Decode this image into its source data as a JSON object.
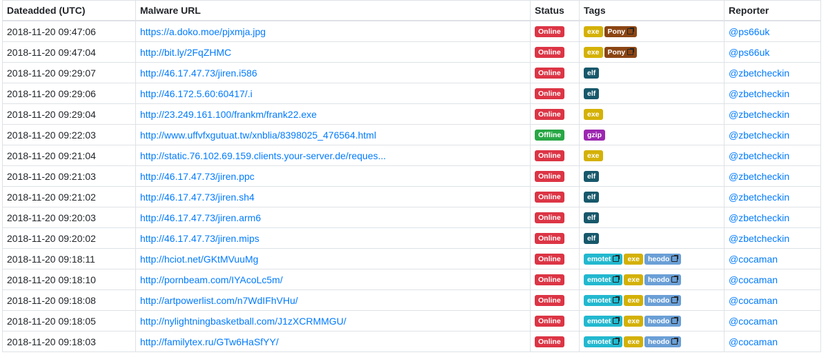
{
  "table": {
    "headers": [
      "Dateadded (UTC)",
      "Malware URL",
      "Status",
      "Tags",
      "Reporter"
    ],
    "rows": [
      {
        "date": "2018-11-20 09:47:06",
        "url": "https://a.doko.moe/pjxmja.jpg",
        "status": "Online",
        "tags": [
          {
            "label": "exe",
            "link": false
          },
          {
            "label": "Pony",
            "link": true
          }
        ],
        "reporter": "@ps66uk"
      },
      {
        "date": "2018-11-20 09:47:04",
        "url": "http://bit.ly/2FqZHMC",
        "status": "Online",
        "tags": [
          {
            "label": "exe",
            "link": false
          },
          {
            "label": "Pony",
            "link": true
          }
        ],
        "reporter": "@ps66uk"
      },
      {
        "date": "2018-11-20 09:29:07",
        "url": "http://46.17.47.73/jiren.i586",
        "status": "Online",
        "tags": [
          {
            "label": "elf",
            "link": false
          }
        ],
        "reporter": "@zbetcheckin"
      },
      {
        "date": "2018-11-20 09:29:06",
        "url": "http://46.172.5.60:60417/.i",
        "status": "Online",
        "tags": [
          {
            "label": "elf",
            "link": false
          }
        ],
        "reporter": "@zbetcheckin"
      },
      {
        "date": "2018-11-20 09:29:04",
        "url": "http://23.249.161.100/frankm/frank22.exe",
        "status": "Online",
        "tags": [
          {
            "label": "exe",
            "link": false
          }
        ],
        "reporter": "@zbetcheckin"
      },
      {
        "date": "2018-11-20 09:22:03",
        "url": "http://www.uffvfxgutuat.tw/xnblia/8398025_476564.html",
        "status": "Offline",
        "tags": [
          {
            "label": "gzip",
            "link": false
          }
        ],
        "reporter": "@zbetcheckin"
      },
      {
        "date": "2018-11-20 09:21:04",
        "url": "http://static.76.102.69.159.clients.your-server.de/reques...",
        "status": "Online",
        "tags": [
          {
            "label": "exe",
            "link": false
          }
        ],
        "reporter": "@zbetcheckin"
      },
      {
        "date": "2018-11-20 09:21:03",
        "url": "http://46.17.47.73/jiren.ppc",
        "status": "Online",
        "tags": [
          {
            "label": "elf",
            "link": false
          }
        ],
        "reporter": "@zbetcheckin"
      },
      {
        "date": "2018-11-20 09:21:02",
        "url": "http://46.17.47.73/jiren.sh4",
        "status": "Online",
        "tags": [
          {
            "label": "elf",
            "link": false
          }
        ],
        "reporter": "@zbetcheckin"
      },
      {
        "date": "2018-11-20 09:20:03",
        "url": "http://46.17.47.73/jiren.arm6",
        "status": "Online",
        "tags": [
          {
            "label": "elf",
            "link": false
          }
        ],
        "reporter": "@zbetcheckin"
      },
      {
        "date": "2018-11-20 09:20:02",
        "url": "http://46.17.47.73/jiren.mips",
        "status": "Online",
        "tags": [
          {
            "label": "elf",
            "link": false
          }
        ],
        "reporter": "@zbetcheckin"
      },
      {
        "date": "2018-11-20 09:18:11",
        "url": "http://hciot.net/GKtMVuuMg",
        "status": "Online",
        "tags": [
          {
            "label": "emotet",
            "link": true
          },
          {
            "label": "exe",
            "link": false
          },
          {
            "label": "heodo",
            "link": true
          }
        ],
        "reporter": "@cocaman"
      },
      {
        "date": "2018-11-20 09:18:10",
        "url": "http://pornbeam.com/IYAcoLc5m/",
        "status": "Online",
        "tags": [
          {
            "label": "emotet",
            "link": true
          },
          {
            "label": "exe",
            "link": false
          },
          {
            "label": "heodo",
            "link": true
          }
        ],
        "reporter": "@cocaman"
      },
      {
        "date": "2018-11-20 09:18:08",
        "url": "http://artpowerlist.com/n7WdIFhVHu/",
        "status": "Online",
        "tags": [
          {
            "label": "emotet",
            "link": true
          },
          {
            "label": "exe",
            "link": false
          },
          {
            "label": "heodo",
            "link": true
          }
        ],
        "reporter": "@cocaman"
      },
      {
        "date": "2018-11-20 09:18:05",
        "url": "http://nylightningbasketball.com/J1zXCRMMGU/",
        "status": "Online",
        "tags": [
          {
            "label": "emotet",
            "link": true
          },
          {
            "label": "exe",
            "link": false
          },
          {
            "label": "heodo",
            "link": true
          }
        ],
        "reporter": "@cocaman"
      },
      {
        "date": "2018-11-20 09:18:03",
        "url": "http://familytex.ru/GTw6HaSfYY/",
        "status": "Online",
        "tags": [
          {
            "label": "emotet",
            "link": true
          },
          {
            "label": "exe",
            "link": false
          },
          {
            "label": "heodo",
            "link": true
          }
        ],
        "reporter": "@cocaman"
      }
    ]
  },
  "colors": {
    "link": "#007bff",
    "online": "#dc3545",
    "offline": "#28a745",
    "exe": "#d4b106",
    "Pony": "#8b4513",
    "elf": "#17586b",
    "gzip": "#9c27b0",
    "emotet": "#22b8cf",
    "heodo": "#6a9fd6"
  },
  "icons": {
    "tag_link": "external-link-icon"
  }
}
